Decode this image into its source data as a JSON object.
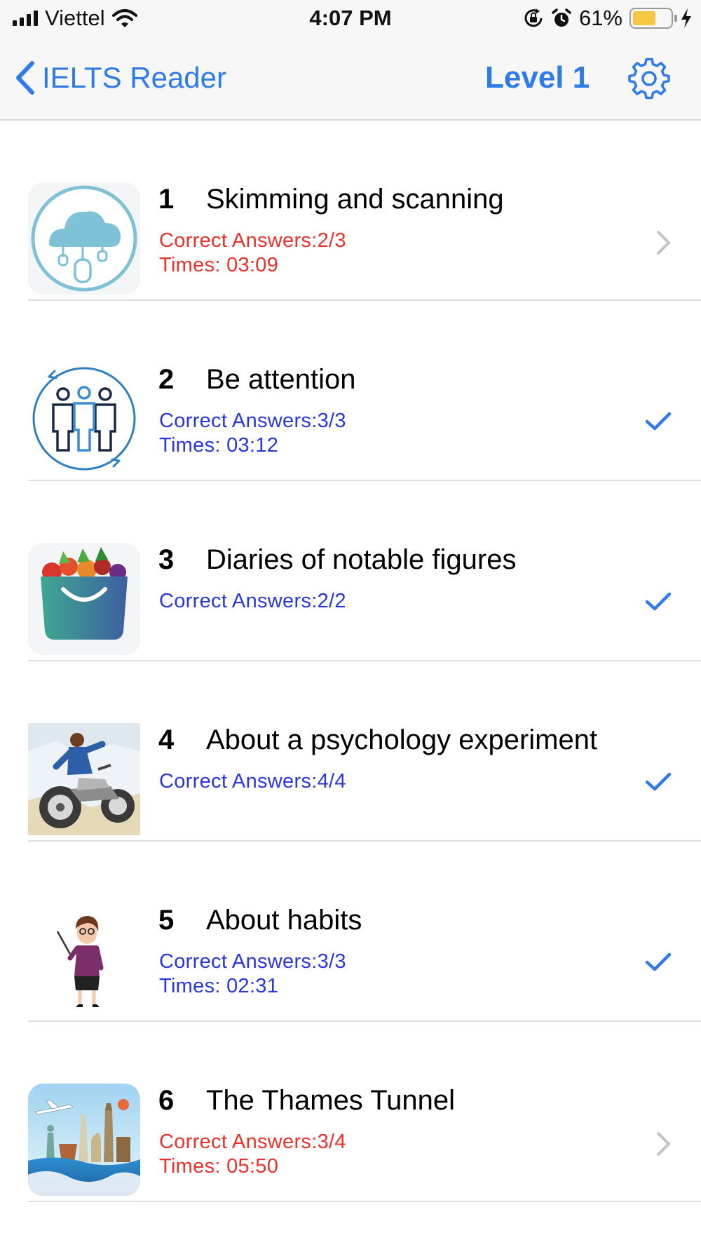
{
  "status_bar": {
    "carrier": "Viettel",
    "time": "4:07 PM",
    "battery_percent": "61%",
    "battery_level": 0.61,
    "icons": [
      "signal-icon",
      "wifi-icon",
      "orientation-lock-icon",
      "alarm-icon",
      "battery-icon",
      "charging-bolt-icon"
    ]
  },
  "nav": {
    "back_label": "IELTS Reader",
    "title": "Level 1",
    "settings_icon": "gear-icon"
  },
  "colors": {
    "accent": "#2f7bea",
    "incomplete": "#e8322a",
    "complete": "#2a36e0"
  },
  "items": [
    {
      "number": "1",
      "title": "Skimming and scanning",
      "answers": "Correct Answers:2/3",
      "time": "Times: 03:09",
      "status": "incomplete",
      "accessory": "chevron-right-icon",
      "thumbnail": "cloud-icon"
    },
    {
      "number": "2",
      "title": "Be attention",
      "answers": "Correct Answers:3/3",
      "time": "Times: 03:12",
      "status": "complete",
      "accessory": "checkmark-icon",
      "thumbnail": "team-icon"
    },
    {
      "number": "3",
      "title": "Diaries of notable figures",
      "answers": "Correct Answers:2/2",
      "time": "",
      "status": "complete",
      "accessory": "checkmark-icon",
      "thumbnail": "vegetable-basket-icon"
    },
    {
      "number": "4",
      "title": "About a psychology experiment",
      "answers": "Correct Answers:4/4",
      "time": "",
      "status": "complete",
      "accessory": "checkmark-icon",
      "thumbnail": "motorbike-illustration"
    },
    {
      "number": "5",
      "title": "About habits",
      "answers": "Correct Answers:3/3",
      "time": "Times: 02:31",
      "status": "complete",
      "accessory": "checkmark-icon",
      "thumbnail": "teacher-illustration"
    },
    {
      "number": "6",
      "title": "The Thames Tunnel",
      "answers": "Correct Answers:3/4",
      "time": "Times: 05:50",
      "status": "incomplete",
      "accessory": "chevron-right-icon",
      "thumbnail": "world-landmarks-illustration"
    }
  ]
}
